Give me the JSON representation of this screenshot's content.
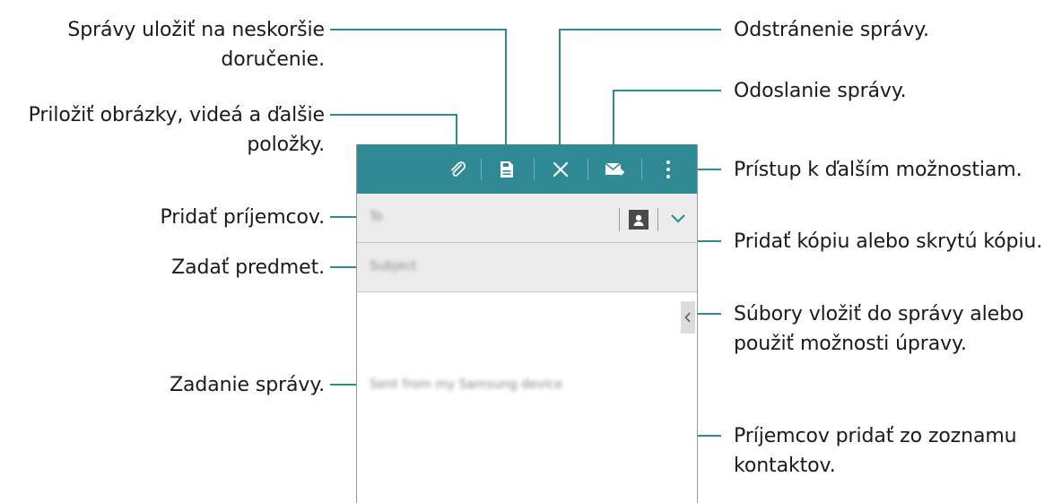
{
  "callouts": {
    "save_later": "Správy uložiť na neskoršie doručenie.",
    "attach": "Priložiť obrázky, videá a ďalšie položky.",
    "add_recipients": "Pridať príjemcov.",
    "enter_subject": "Zadať predmet.",
    "enter_message": "Zadanie správy.",
    "delete_message": "Odstránenie správy.",
    "send_message": "Odoslanie správy.",
    "more_options": "Prístup k ďalším možnostiam.",
    "add_cc_bcc": "Pridať kópiu alebo skrytú kópiu.",
    "insert_files": "Súbory vložiť do správy alebo použiť možnosti úpravy.",
    "add_from_contacts": "Príjemcov pridať zo zoznamu kontaktov."
  },
  "compose": {
    "to_placeholder": "To",
    "subject_placeholder": "Subject",
    "body_signature": "Sent from my Samsung device"
  },
  "icons": {
    "attach": "paperclip-icon",
    "save": "save-icon",
    "discard": "close-icon",
    "send": "send-mail-icon",
    "more": "more-vertical-icon",
    "contacts": "contact-icon",
    "expand": "chevron-down-icon",
    "edge": "chevron-left-icon"
  },
  "colors": {
    "action_bar": "#2f8a96",
    "leader_line": "#2f8a96",
    "field_bg": "#ececec"
  }
}
